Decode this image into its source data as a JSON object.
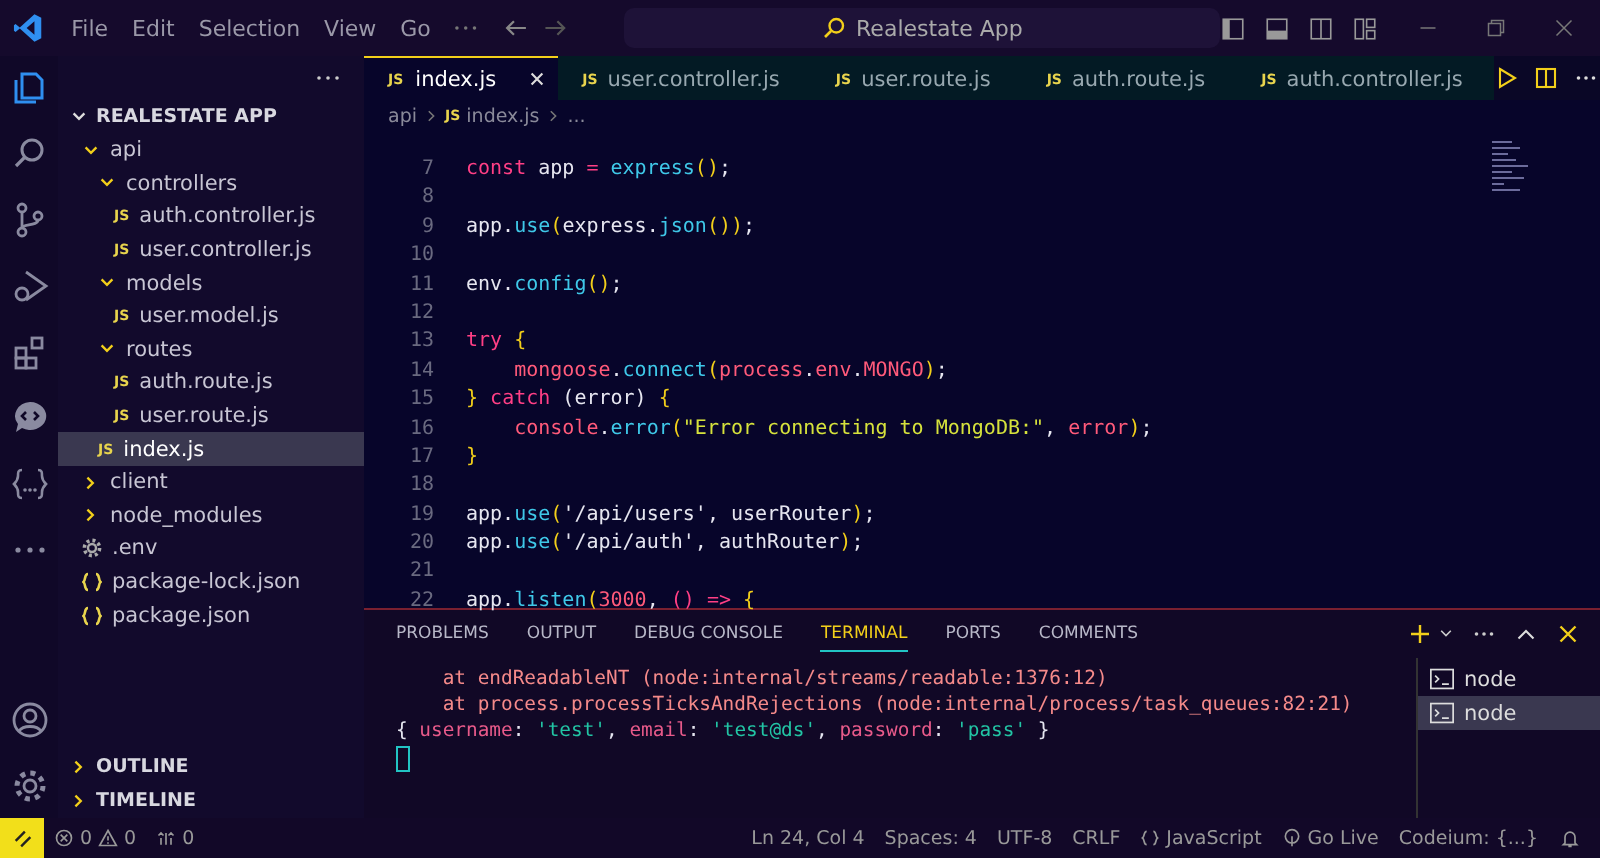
{
  "title_bar": {
    "menu": [
      "File",
      "Edit",
      "Selection",
      "View",
      "Go"
    ],
    "search": {
      "value": "Realestate App"
    }
  },
  "activity_bar": [
    {
      "kind": "explorer",
      "selected": true
    },
    {
      "kind": "search",
      "selected": false
    },
    {
      "kind": "source-control",
      "selected": false
    },
    {
      "kind": "run",
      "selected": false
    },
    {
      "kind": "extensions",
      "selected": false
    },
    {
      "kind": "chat",
      "selected": false
    },
    {
      "kind": "braces",
      "selected": false
    },
    {
      "kind": "more",
      "selected": false
    }
  ],
  "sidebar": {
    "project": "REALESTATE APP",
    "tree": [
      {
        "name": "api",
        "kind": "folder",
        "expanded": true,
        "selected": false,
        "children": [
          {
            "name": "controllers",
            "kind": "folder",
            "expanded": true,
            "selected": false,
            "children": [
              {
                "name": "auth.controller.js",
                "kind": "js",
                "badge": "JS",
                "selected": false
              },
              {
                "name": "user.controller.js",
                "kind": "js",
                "badge": "JS",
                "selected": false
              }
            ]
          },
          {
            "name": "models",
            "kind": "folder",
            "expanded": true,
            "selected": false,
            "children": [
              {
                "name": "user.model.js",
                "kind": "js",
                "badge": "JS",
                "selected": false
              }
            ]
          },
          {
            "name": "routes",
            "kind": "folder",
            "expanded": true,
            "selected": false,
            "children": [
              {
                "name": "auth.route.js",
                "kind": "js",
                "badge": "JS",
                "selected": false
              },
              {
                "name": "user.route.js",
                "kind": "js",
                "badge": "JS",
                "selected": false
              }
            ]
          },
          {
            "name": "index.js",
            "kind": "js",
            "badge": "JS",
            "selected": true
          }
        ]
      },
      {
        "name": "client",
        "kind": "folder",
        "expanded": false,
        "selected": false
      },
      {
        "name": "node_modules",
        "kind": "folder",
        "expanded": false,
        "selected": false
      },
      {
        "name": ".env",
        "kind": "env",
        "selected": false
      },
      {
        "name": "package-lock.json",
        "kind": "json",
        "selected": false
      },
      {
        "name": "package.json",
        "kind": "json",
        "selected": false
      }
    ],
    "sections": [
      "OUTLINE",
      "TIMELINE"
    ]
  },
  "editor_tabs": [
    {
      "label": "index.js",
      "badge": "JS",
      "selected": true
    },
    {
      "label": "user.controller.js",
      "badge": "JS",
      "selected": false
    },
    {
      "label": "user.route.js",
      "badge": "JS",
      "selected": false
    },
    {
      "label": "auth.route.js",
      "badge": "JS",
      "selected": false
    },
    {
      "label": "auth.controller.js",
      "badge": "JS",
      "selected": false
    }
  ],
  "breadcrumb": [
    {
      "label": "api"
    },
    {
      "label": "index.js",
      "badge": "JS"
    },
    {
      "label": "..."
    }
  ],
  "code_lines": [
    {
      "number": "7",
      "tokens": [
        {
          "text": "const",
          "kind": "keyword"
        },
        {
          "text": " app ",
          "kind": "plain"
        },
        {
          "text": "=",
          "kind": "keyword"
        },
        {
          "text": " express",
          "kind": "function"
        },
        {
          "text": "()",
          "kind": "paren"
        },
        {
          "text": ";",
          "kind": "plain"
        }
      ]
    },
    {
      "number": "8"
    },
    {
      "number": "9",
      "tokens": [
        {
          "text": "app.",
          "kind": "plain"
        },
        {
          "text": "use",
          "kind": "function"
        },
        {
          "text": "(",
          "kind": "paren"
        },
        {
          "text": "express.",
          "kind": "plain"
        },
        {
          "text": "json",
          "kind": "function"
        },
        {
          "text": "())",
          "kind": "paren"
        },
        {
          "text": ";",
          "kind": "plain"
        }
      ]
    },
    {
      "number": "10"
    },
    {
      "number": "11",
      "tokens": [
        {
          "text": "env.",
          "kind": "plain"
        },
        {
          "text": "config",
          "kind": "function"
        },
        {
          "text": "()",
          "kind": "paren"
        },
        {
          "text": ";",
          "kind": "plain"
        }
      ]
    },
    {
      "number": "12"
    },
    {
      "number": "13",
      "tokens": [
        {
          "text": "try",
          "kind": "keyword"
        },
        {
          "text": " {",
          "kind": "paren"
        }
      ]
    },
    {
      "number": "14",
      "tokens": [
        {
          "text": "    mongoose",
          "kind": "variable"
        },
        {
          "text": ".",
          "kind": "plain"
        },
        {
          "text": "connect",
          "kind": "function"
        },
        {
          "text": "(",
          "kind": "paren"
        },
        {
          "text": "process",
          "kind": "variable"
        },
        {
          "text": ".",
          "kind": "plain"
        },
        {
          "text": "env",
          "kind": "variable"
        },
        {
          "text": ".",
          "kind": "plain"
        },
        {
          "text": "MONGO",
          "kind": "variable"
        },
        {
          "text": ")",
          "kind": "paren"
        },
        {
          "text": ";",
          "kind": "plain"
        }
      ]
    },
    {
      "number": "15",
      "tokens": [
        {
          "text": "} ",
          "kind": "paren"
        },
        {
          "text": "catch",
          "kind": "keyword"
        },
        {
          "text": " (error) ",
          "kind": "plain"
        },
        {
          "text": "{",
          "kind": "paren"
        }
      ]
    },
    {
      "number": "16",
      "tokens": [
        {
          "text": "    console",
          "kind": "variable"
        },
        {
          "text": ".",
          "kind": "plain"
        },
        {
          "text": "error",
          "kind": "function"
        },
        {
          "text": "(",
          "kind": "paren"
        },
        {
          "text": "\"Error connecting to MongoDB:\"",
          "kind": "string"
        },
        {
          "text": ", ",
          "kind": "plain"
        },
        {
          "text": "error",
          "kind": "variable"
        },
        {
          "text": ")",
          "kind": "paren"
        },
        {
          "text": ";",
          "kind": "plain"
        }
      ]
    },
    {
      "number": "17",
      "tokens": [
        {
          "text": "}",
          "kind": "paren"
        }
      ]
    },
    {
      "number": "18"
    },
    {
      "number": "19",
      "tokens": [
        {
          "text": "app.",
          "kind": "plain"
        },
        {
          "text": "use",
          "kind": "function"
        },
        {
          "text": "(",
          "kind": "paren"
        },
        {
          "text": "'/api/users'",
          "kind": "plain"
        },
        {
          "text": ", userRouter",
          "kind": "plain"
        },
        {
          "text": ")",
          "kind": "paren"
        },
        {
          "text": ";",
          "kind": "plain"
        }
      ]
    },
    {
      "number": "20",
      "tokens": [
        {
          "text": "app.",
          "kind": "plain"
        },
        {
          "text": "use",
          "kind": "function"
        },
        {
          "text": "(",
          "kind": "paren"
        },
        {
          "text": "'/api/auth'",
          "kind": "plain"
        },
        {
          "text": ", authRouter",
          "kind": "plain"
        },
        {
          "text": ")",
          "kind": "paren"
        },
        {
          "text": ";",
          "kind": "plain"
        }
      ]
    },
    {
      "number": "21"
    },
    {
      "number": "22",
      "tokens": [
        {
          "text": "app.",
          "kind": "plain"
        },
        {
          "text": "listen",
          "kind": "function"
        },
        {
          "text": "(",
          "kind": "paren"
        },
        {
          "text": "3000",
          "kind": "variable"
        },
        {
          "text": ", ",
          "kind": "plain"
        },
        {
          "text": "() =>",
          "kind": "keyword"
        },
        {
          "text": " {",
          "kind": "paren"
        }
      ]
    }
  ],
  "panel": {
    "tabs": [
      {
        "label": "PROBLEMS",
        "selected": false
      },
      {
        "label": "OUTPUT",
        "selected": false
      },
      {
        "label": "DEBUG CONSOLE",
        "selected": false
      },
      {
        "label": "TERMINAL",
        "selected": true
      },
      {
        "label": "PORTS",
        "selected": false
      },
      {
        "label": "COMMENTS",
        "selected": false
      }
    ],
    "terminal_lines": [
      [
        {
          "text": "    at endReadableNT (node:internal/streams/readable:1376:12)",
          "kind": "stack"
        }
      ],
      [
        {
          "text": "    at process.processTicksAndRejections (node:internal/process/task_queues:82:21)",
          "kind": "stack"
        }
      ],
      [
        {
          "text": "{ ",
          "kind": "plain"
        },
        {
          "text": "username",
          "kind": "key"
        },
        {
          "text": ": ",
          "kind": "plain"
        },
        {
          "text": "'test'",
          "kind": "string"
        },
        {
          "text": ", ",
          "kind": "plain"
        },
        {
          "text": "email",
          "kind": "key"
        },
        {
          "text": ": ",
          "kind": "plain"
        },
        {
          "text": "'test@ds'",
          "kind": "string"
        },
        {
          "text": ", ",
          "kind": "plain"
        },
        {
          "text": "password",
          "kind": "key"
        },
        {
          "text": ": ",
          "kind": "plain"
        },
        {
          "text": "'pass'",
          "kind": "string"
        },
        {
          "text": " }",
          "kind": "plain"
        }
      ]
    ],
    "terminals": [
      {
        "label": "node",
        "selected": false
      },
      {
        "label": "node",
        "selected": true
      }
    ]
  },
  "status_bar": {
    "errors": "0",
    "warnings": "0",
    "ports": "0",
    "right": [
      {
        "text": "Ln 24, Col 4",
        "kind": "text"
      },
      {
        "text": "Spaces: 4",
        "kind": "text"
      },
      {
        "text": "UTF-8",
        "kind": "text"
      },
      {
        "text": "CRLF",
        "kind": "text"
      },
      {
        "text": "JavaScript",
        "kind": "language"
      },
      {
        "text": "Go Live",
        "kind": "live"
      },
      {
        "text": "Codeium: {...}",
        "kind": "text"
      }
    ]
  }
}
